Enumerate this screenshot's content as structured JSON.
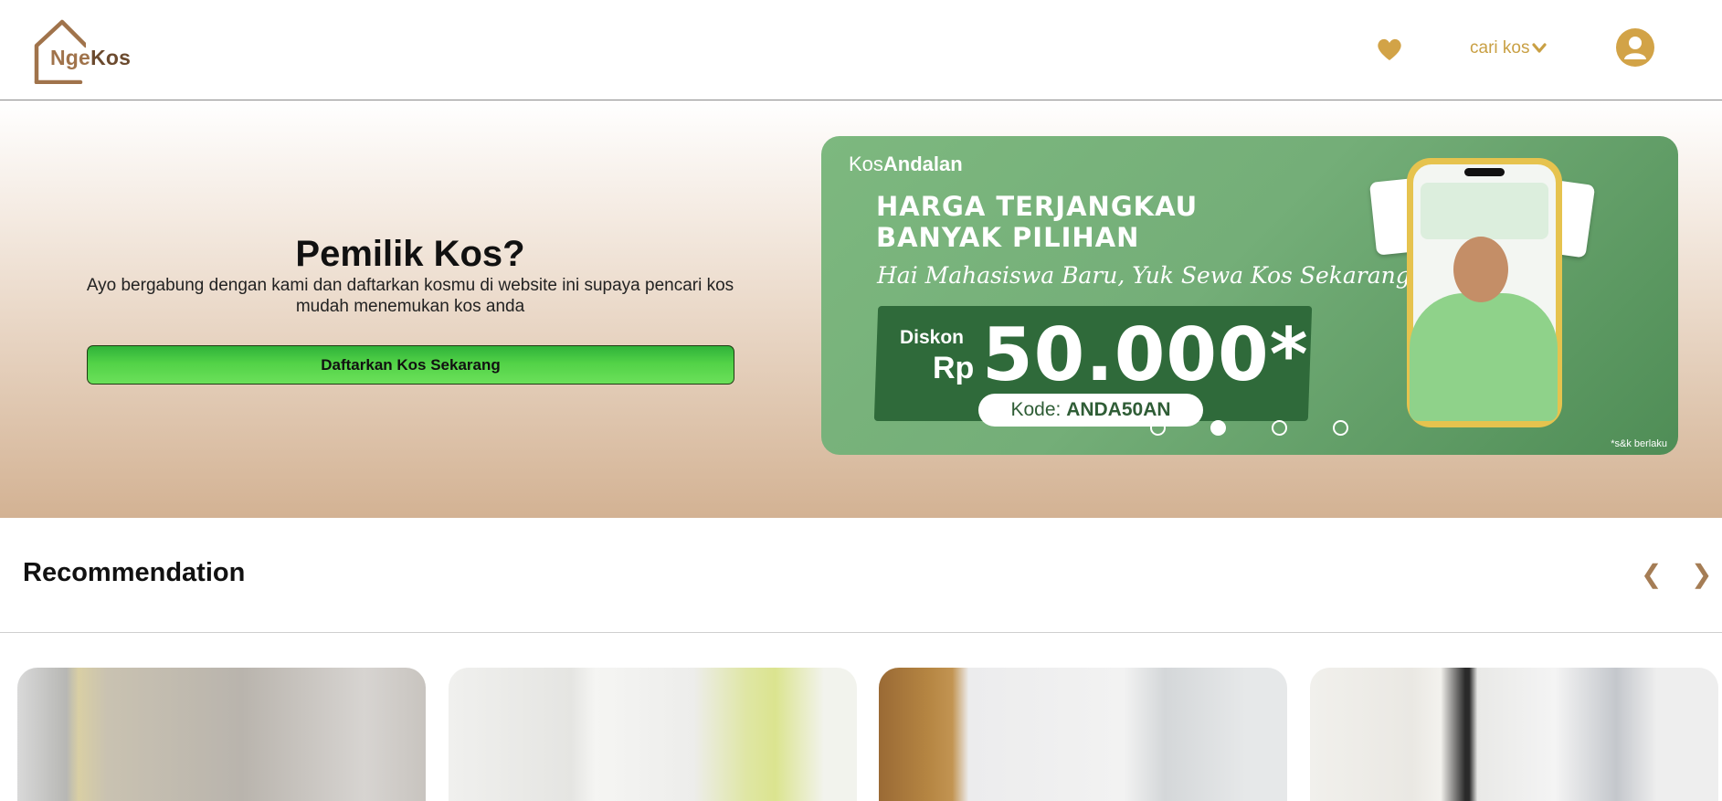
{
  "header": {
    "logo": {
      "part1": "Nge",
      "part2": "Kos"
    },
    "favorite_icon": "heart-icon",
    "search_menu_label": "cari kos",
    "search_menu_icon": "chevron-down-icon",
    "profile_icon": "user-icon",
    "accent_color": "#c9a044"
  },
  "hero": {
    "title": "Pemilik Kos?",
    "description": "Ayo bergabung dengan kami dan daftarkan kosmu di website ini supaya pencari kos mudah menemukan kos anda",
    "cta_label": "Daftarkan Kos Sekarang",
    "cta_color": "#52d247"
  },
  "banner": {
    "brand_light": "Kos",
    "brand_bold": "Andalan",
    "headline_line1": "HARGA TERJANGKAU",
    "headline_line2": "BANYAK PILIHAN",
    "subheadline": "Hai Mahasiswa Baru, Yuk Sewa Kos Sekarang",
    "discount_label": "Diskon",
    "currency": "Rp",
    "amount": "50.000*",
    "code_label": "Kode:",
    "code_value": "ANDA50AN",
    "terms": "*s&k berlaku",
    "slides_total": 4,
    "active_slide": 2
  },
  "recommendation": {
    "title": "Recommendation",
    "prev_icon": "chevron-left-icon",
    "next_icon": "chevron-right-icon",
    "prev_glyph": "❮",
    "next_glyph": "❯"
  }
}
